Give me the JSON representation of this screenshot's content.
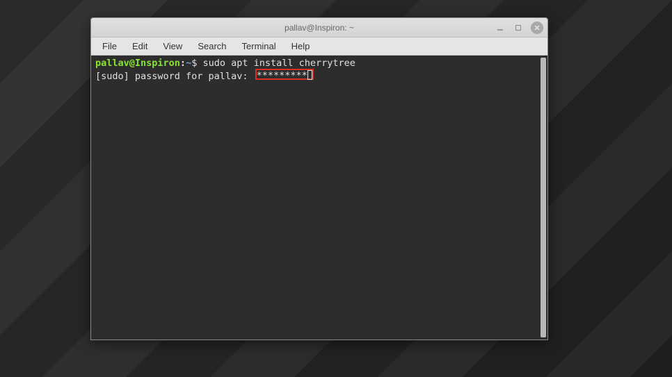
{
  "window": {
    "title": "pallav@Inspiron: ~"
  },
  "menubar": {
    "items": [
      "File",
      "Edit",
      "View",
      "Search",
      "Terminal",
      "Help"
    ]
  },
  "terminal": {
    "prompt": {
      "user_host": "pallav@Inspiron",
      "separator": ":",
      "path": "~",
      "symbol": "$"
    },
    "command": "sudo apt install cherrytree",
    "output_prefix": "[sudo] password for pallav: ",
    "password_masked": "*********"
  }
}
